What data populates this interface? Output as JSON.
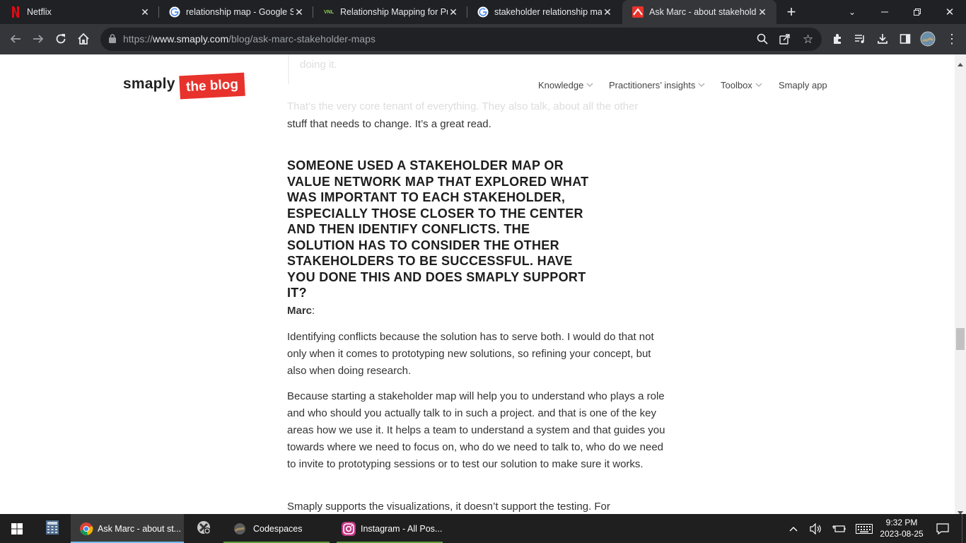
{
  "browser": {
    "tabs": [
      {
        "title": "Netflix",
        "icon": "netflix-icon"
      },
      {
        "title": "relationship map - Google Se",
        "icon": "google-icon"
      },
      {
        "title": "Relationship Mapping for Pul",
        "icon": "vnl-icon"
      },
      {
        "title": "stakeholder relationship map",
        "icon": "google-icon"
      },
      {
        "title": "Ask Marc - about stakeholde",
        "icon": "smaply-icon",
        "active": true
      }
    ],
    "url_prefix": "https://",
    "url_domain": "www.smaply.com",
    "url_path": "/blog/ask-marc-stakeholder-maps"
  },
  "site": {
    "logo_text": "smaply",
    "logo_badge": "the blog",
    "nav": [
      {
        "label": "Knowledge",
        "dropdown": true
      },
      {
        "label": "Practitioners’ insights",
        "dropdown": true
      },
      {
        "label": "Toolbox",
        "dropdown": true
      },
      {
        "label": "Smaply app",
        "dropdown": false
      }
    ]
  },
  "article": {
    "faded_top": "doing it.",
    "faded_line": "That’s the very core tenant of everything. They also talk, about all the other",
    "para0_end": "stuff that needs to change. It’s a great read.",
    "question": "Someone used a stakeholder map or value network map that explored what was important to each stakeholder, especially those closer to the center and then identify conflicts. The solution has to consider the other stakeholders to be successful. Have you done this and does Smaply support it?",
    "speaker": "Marc",
    "speaker_colon": ":",
    "para1": "Identifying conflicts because the solution has to serve both. I would do that not only when it comes to prototyping new solutions, so refining your concept, but also when doing research.",
    "para2": "Because starting a stakeholder map will help you to understand who plays a role and who should you actually talk to in such a project. and that is one of the key areas how we use it. It helps a team to understand a system and that guides you towards where we need to focus on, who do we need to talk to, who do we need to invite to prototyping sessions or to test our solution to make sure it works.",
    "para3": "Smaply supports the visualizations, it doesn’t support the testing. For"
  },
  "taskbar": {
    "apps": [
      {
        "label": "",
        "icon": "calculator-icon"
      },
      {
        "label": "Ask Marc - about st...",
        "icon": "chrome-icon",
        "active": true
      },
      {
        "label": "",
        "icon": "settings-app-icon"
      },
      {
        "label": "Codespaces",
        "icon": "codespaces-icon"
      },
      {
        "label": "Instagram - All Pos...",
        "icon": "instagram-icon"
      }
    ],
    "time": "9:32 PM",
    "date": "2023-08-25"
  },
  "colors": {
    "brand_red": "#e8322c",
    "chrome_dark": "#202124",
    "chrome_toolbar": "#35363a"
  }
}
